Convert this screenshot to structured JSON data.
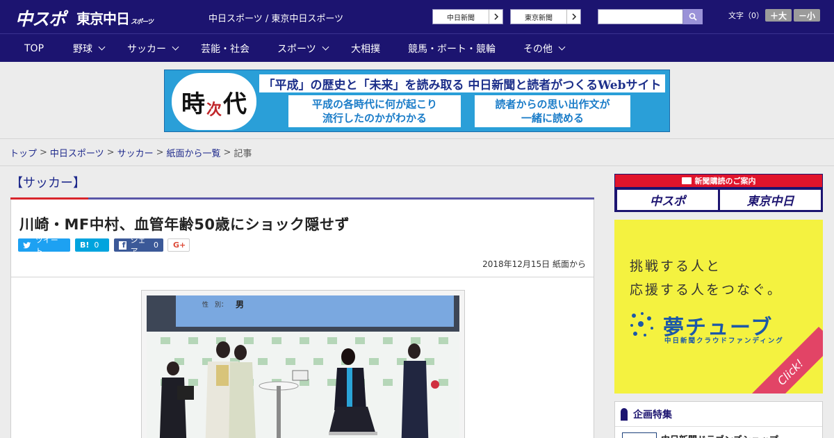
{
  "header": {
    "logo_chuspo": "中スポ",
    "logo_tokyo": "東京中日",
    "logo_tokyo_small": "スポーツ",
    "site_title": "中日スポーツ / 東京中日スポーツ",
    "ext_links": [
      {
        "label": "中日新聞"
      },
      {
        "label": "東京新聞"
      }
    ],
    "search_placeholder": "",
    "font_size_label": "文字（0）",
    "font_bigger": "＋大",
    "font_smaller": "－小"
  },
  "nav": {
    "items": [
      {
        "label": "TOP",
        "dropdown": false
      },
      {
        "label": "野球",
        "dropdown": true
      },
      {
        "label": "サッカー",
        "dropdown": true
      },
      {
        "label": "芸能・社会",
        "dropdown": false
      },
      {
        "label": "スポーツ",
        "dropdown": true
      },
      {
        "label": "大相撲",
        "dropdown": false
      },
      {
        "label": "競馬・ボート・競輪",
        "dropdown": false
      },
      {
        "label": "その他",
        "dropdown": true
      }
    ]
  },
  "banner": {
    "logo_ji": "時",
    "logo_ji2": "次",
    "logo_dai": "代",
    "headline": "「平成」の歴史と「未来」を読み取る 中日新聞と読者がつくるWebサイト",
    "box_left_1": "平成の各時代に何が起こり",
    "box_left_2": "流行したのかがわかる",
    "box_right_1": "読者からの思い出作文が",
    "box_right_2": "一緒に読める"
  },
  "breadcrumb": {
    "items": [
      "トップ",
      "中日スポーツ",
      "サッカー",
      "紙面から一覧"
    ],
    "current": "記事"
  },
  "article": {
    "category": "【サッカー】",
    "title": "川崎・MF中村、血管年齢50歳にショック隠せず",
    "share": {
      "tweet": "ツイート",
      "hatena_label": "B!",
      "hatena_count": "0",
      "facebook_label": "シェア",
      "facebook_count": "0",
      "gplus": "G+"
    },
    "date": "2018年12月15日 紙面から",
    "photo": {
      "screen_field": "性　別：",
      "screen_value": "男"
    }
  },
  "sidebar": {
    "subscribe_header": "新聞購読のご案内",
    "sub_logo_1": "中スポ",
    "sub_logo_2": "東京中日",
    "yume_line_1": "挑戦する人と",
    "yume_line_2": "応援する人をつなぐ。",
    "yume_brand": "夢チューブ",
    "yume_sub": "中日新聞クラウドファンディング",
    "yume_click": "Click!",
    "kikaku_title": "企画特集",
    "kikaku_item": "中日新聞ドラゴンズショップ"
  },
  "colors": {
    "header_bg": "#1c1470",
    "accent_red": "#d8252c",
    "link": "#1f2a8c",
    "twitter": "#1da1f2",
    "hatena": "#00a4de",
    "facebook": "#3b5998",
    "yume_bg": "#f4f240"
  }
}
